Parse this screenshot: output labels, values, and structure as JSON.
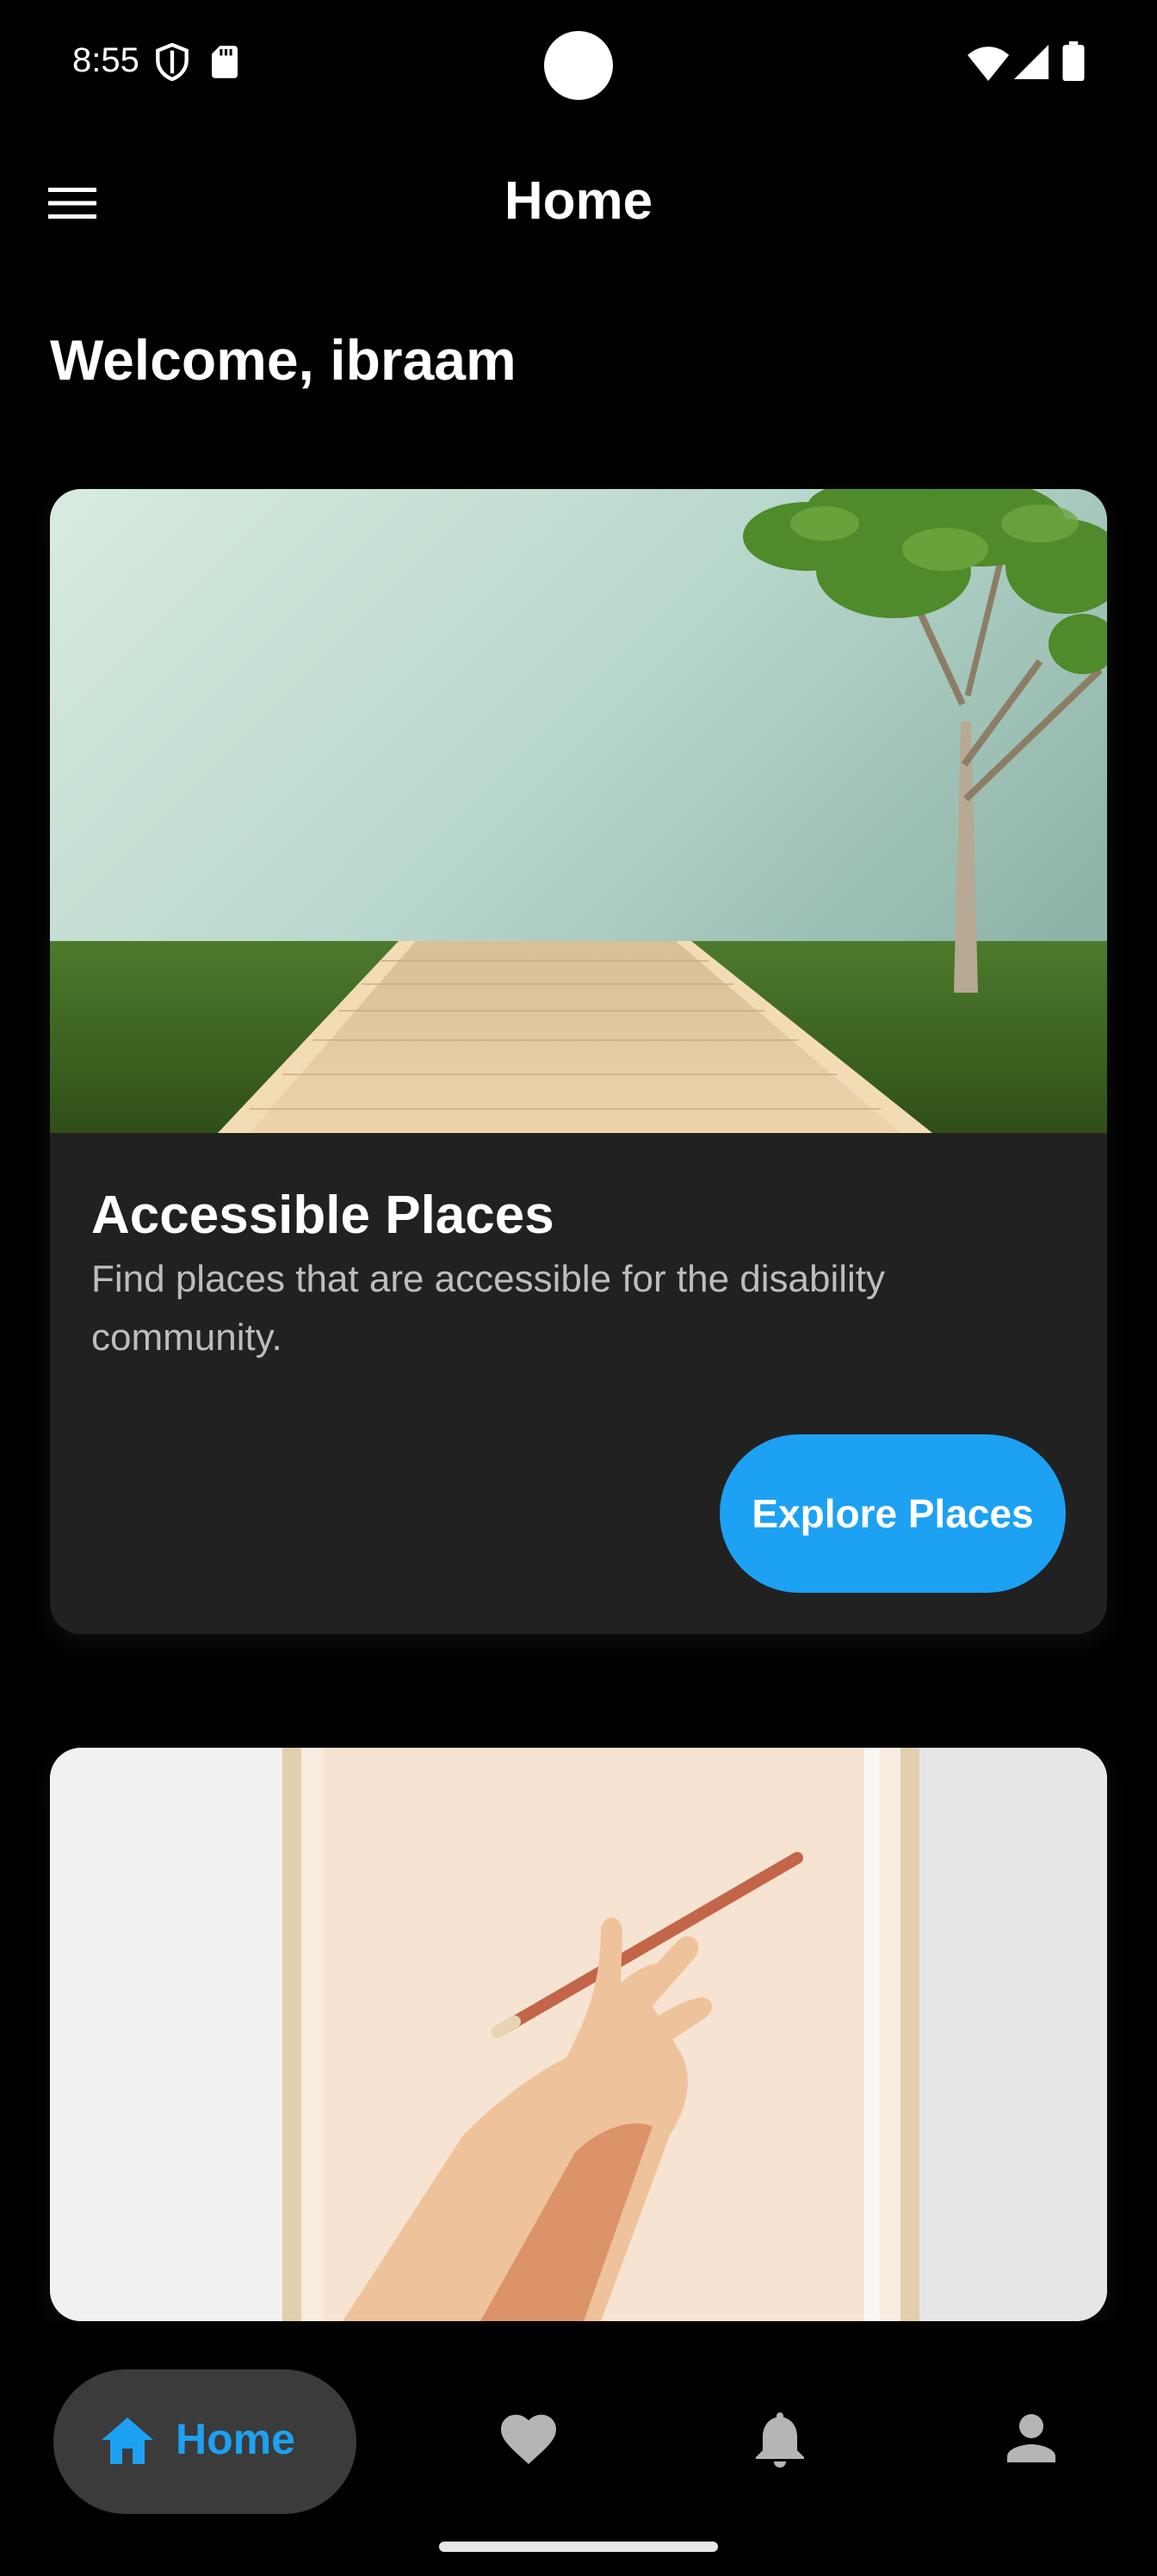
{
  "status_bar": {
    "time": "8:55",
    "icons": [
      "shield-icon",
      "sd-card-icon",
      "wifi-icon",
      "cell-signal-icon",
      "battery-icon"
    ]
  },
  "app_bar": {
    "title": "Home",
    "menu_icon": "hamburger-menu-icon"
  },
  "welcome_text": "Welcome, ibraam",
  "cards": [
    {
      "image": "wooden ramp path across grass with tree",
      "title": "Accessible Places",
      "description": "Find places that are accessible for the disability community.",
      "button_label": "Explore Places"
    },
    {
      "image": "illustration of a hand holding a pencil in a frame"
    }
  ],
  "bottom_nav": {
    "items": [
      {
        "label": "Home",
        "icon": "home-icon",
        "active": true
      },
      {
        "label": "",
        "icon": "heart-icon",
        "active": false
      },
      {
        "label": "",
        "icon": "bell-icon",
        "active": false
      },
      {
        "label": "",
        "icon": "person-icon",
        "active": false
      }
    ]
  },
  "colors": {
    "background": "#000000",
    "card": "#212121",
    "accent": "#1DA1F2",
    "nav_pill": "#3B3B3B",
    "inactive_icon": "#B5B5B5"
  }
}
